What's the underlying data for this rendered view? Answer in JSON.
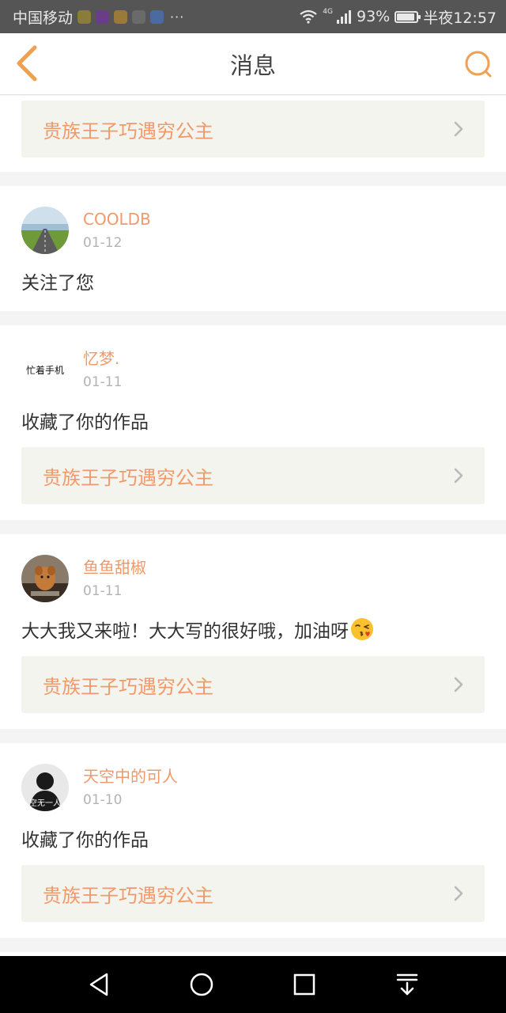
{
  "status_bar": {
    "carrier": "中国移动",
    "more": "···",
    "network": "4G",
    "battery": "93%",
    "battery_level": 0.93,
    "time": "半夜12:57"
  },
  "header": {
    "title": "消息",
    "back_icon": "back-chevron-icon",
    "search_icon": "search-icon"
  },
  "colors": {
    "accent": "#f0996a",
    "header_icon": "#f0a050",
    "card_link_bg": "#f4f4ee"
  },
  "partial_card": {
    "work_title": "贵族王子巧遇穷公主"
  },
  "messages": [
    {
      "username": "COOLDB",
      "date": "01-12",
      "text": "关注了您",
      "avatar_icon": "road-landscape-avatar"
    },
    {
      "username": "忆梦.",
      "date": "01-11",
      "text": "收藏了你的作品",
      "work_title": "贵族王子巧遇穷公主",
      "avatar_icon": "calligraphy-avatar",
      "avatar_text": "忙着手机"
    },
    {
      "username": "鱼鱼甜椒",
      "date": "01-11",
      "text": "大大我又来啦！大大写的很好哦，加油呀",
      "emoji": "kissing-face-emoji",
      "work_title": "贵族王子巧遇穷公主",
      "avatar_icon": "dog-photo-avatar"
    },
    {
      "username": "天空中的可人",
      "date": "01-10",
      "text": "收藏了你的作品",
      "work_title": "贵族王子巧遇穷公主",
      "avatar_icon": "dark-figure-avatar",
      "avatar_text": "空无一人"
    }
  ],
  "nav_bar": {
    "back": "triangle-back-icon",
    "home": "circle-home-icon",
    "recents": "square-recents-icon",
    "notifications": "pull-down-icon"
  }
}
